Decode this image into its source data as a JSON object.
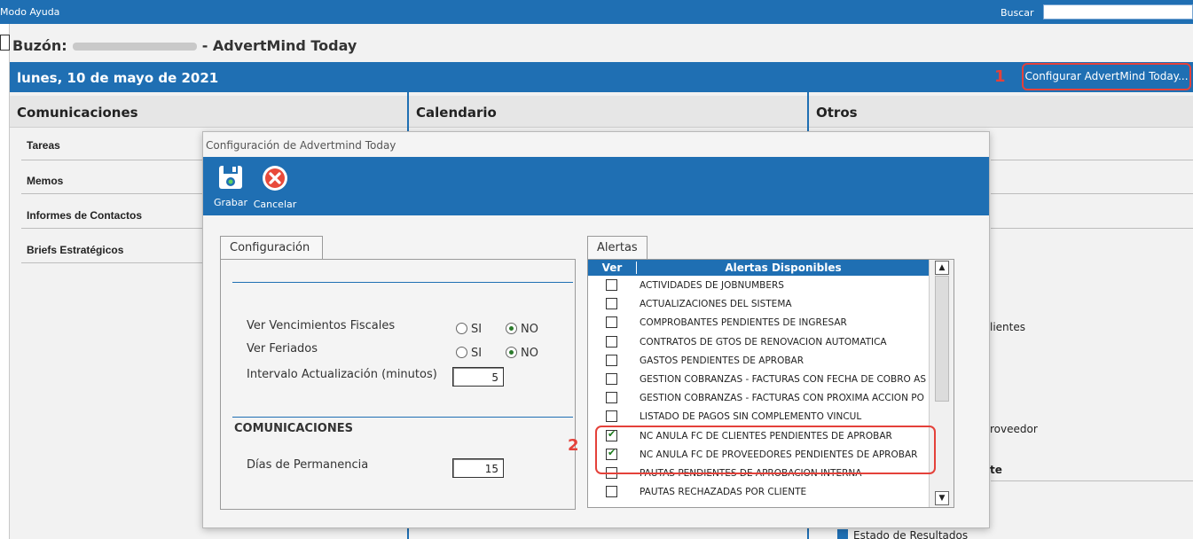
{
  "topbar": {
    "help_label": "Modo Ayuda",
    "search_label": "Buscar",
    "search_value": ""
  },
  "header": {
    "mailbox_prefix": "Buzón:",
    "mailbox_suffix": "- AdvertMind Today"
  },
  "datebar": {
    "date": "lunes, 10 de mayo de 2021",
    "step_1": "1",
    "configure_button": "Configurar AdvertMind Today..."
  },
  "columns": {
    "comms": "Comunicaciones",
    "calendar": "Calendario",
    "others": "Otros"
  },
  "comms_items": [
    "Tareas",
    "Memos",
    "Informes de Contactos",
    "Briefs Estratégicos"
  ],
  "right_fragments": {
    "frag_a": "lientes",
    "frag_b": "roveedor",
    "frag_c": "te",
    "frag_d": "Estado de Resultados"
  },
  "modal": {
    "title": "Configuración de Advertmind Today",
    "save_label": "Grabar",
    "cancel_label": "Cancelar",
    "config_tab": "Configuración",
    "fiscal_label": "Ver Vencimientos Fiscales",
    "holidays_label": "Ver Feriados",
    "si": "SI",
    "no": "NO",
    "interval_label": "Intervalo Actualización (minutos)",
    "interval_value": "5",
    "comms_section": "COMUNICACIONES",
    "stay_label": "Días de Permanencia",
    "stay_value": "15",
    "alerts_tab": "Alertas",
    "col_ver": "Ver",
    "col_alerts": "Alertas Disponibles",
    "step_2": "2"
  },
  "alerts": [
    {
      "label": "ACTIVIDADES DE JOBNUMBERS",
      "checked": false
    },
    {
      "label": "ACTUALIZACIONES DEL SISTEMA",
      "checked": false
    },
    {
      "label": "COMPROBANTES PENDIENTES DE INGRESAR",
      "checked": false
    },
    {
      "label": "CONTRATOS DE GTOS DE RENOVACION AUTOMATICA",
      "checked": false
    },
    {
      "label": "GASTOS PENDIENTES DE APROBAR",
      "checked": false
    },
    {
      "label": "GESTION COBRANZAS - FACTURAS CON FECHA DE COBRO AS",
      "checked": false
    },
    {
      "label": "GESTION COBRANZAS - FACTURAS CON PROXIMA ACCION PO",
      "checked": false
    },
    {
      "label": "LISTADO DE PAGOS SIN COMPLEMENTO VINCUL",
      "checked": false
    },
    {
      "label": "NC ANULA FC DE CLIENTES PENDIENTES DE APROBAR",
      "checked": true
    },
    {
      "label": "NC ANULA FC DE PROVEEDORES PENDIENTES DE APROBAR",
      "checked": true
    },
    {
      "label": "PAUTAS PENDIENTES DE APROBACION INTERNA",
      "checked": false
    },
    {
      "label": "PAUTAS RECHAZADAS POR CLIENTE",
      "checked": false
    }
  ],
  "colors": {
    "brand_blue": "#1f6fb3",
    "highlight_red": "#e4413a"
  }
}
